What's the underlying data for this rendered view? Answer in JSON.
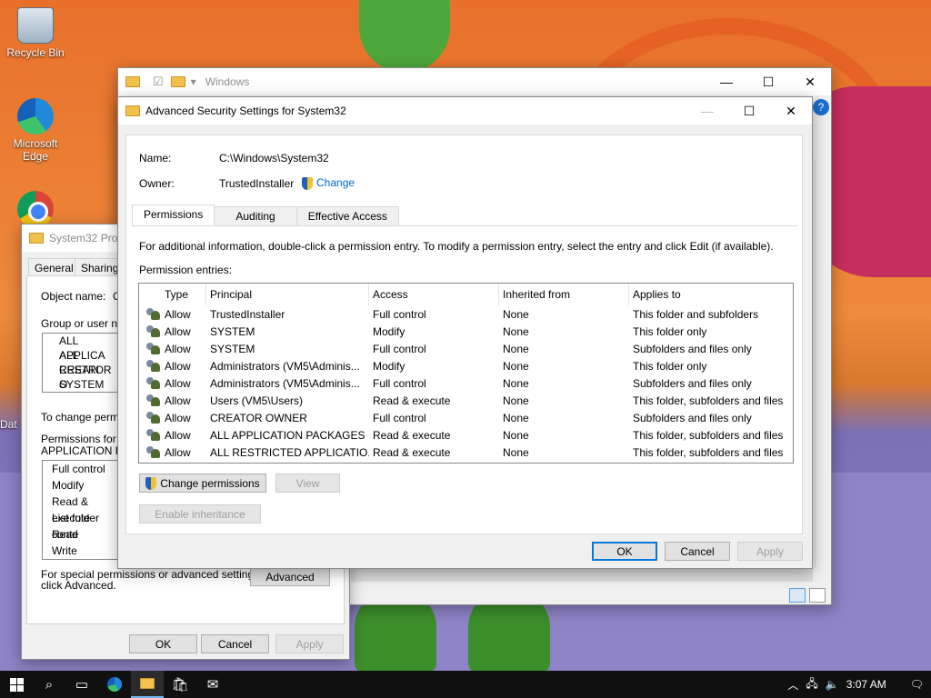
{
  "desktop": {
    "icons": [
      {
        "label": "Recycle Bin"
      },
      {
        "label": "Microsoft Edge"
      },
      {
        "label": "Dat"
      }
    ]
  },
  "explorer": {
    "title": "Windows"
  },
  "properties": {
    "title": "System32 Prop",
    "tabs": [
      "General",
      "Sharing"
    ],
    "object_name_label": "Object name:",
    "object_name_value": "C",
    "group_label": "Group or user nam",
    "groups": [
      "ALL APPLICA",
      "ALL RESTRI",
      "CREATOR O",
      "SYSTEM"
    ],
    "change_perms_text": "To change permis",
    "perms_for_label_1": "Permissions for AL",
    "perms_for_label_2": "APPLICATION PA",
    "perm_list": [
      "Full control",
      "Modify",
      "Read & execute",
      "List folder conte",
      "Read",
      "Write"
    ],
    "special_text_1": "For special permissions or advanced settings,",
    "special_text_2": "click Advanced.",
    "advanced_button": "Advanced",
    "ok_button": "OK",
    "cancel_button": "Cancel",
    "apply_button": "Apply"
  },
  "advanced": {
    "title": "Advanced Security Settings for System32",
    "name_label": "Name:",
    "name_value": "C:\\Windows\\System32",
    "owner_label": "Owner:",
    "owner_value": "TrustedInstaller",
    "change_link": "Change",
    "tabs": [
      "Permissions",
      "Auditing",
      "Effective Access"
    ],
    "info_text": "For additional information, double-click a permission entry. To modify a permission entry, select the entry and click Edit (if available).",
    "entries_label": "Permission entries:",
    "columns": [
      "Type",
      "Principal",
      "Access",
      "Inherited from",
      "Applies to"
    ],
    "rows": [
      [
        "Allow",
        "TrustedInstaller",
        "Full control",
        "None",
        "This folder and subfolders"
      ],
      [
        "Allow",
        "SYSTEM",
        "Modify",
        "None",
        "This folder only"
      ],
      [
        "Allow",
        "SYSTEM",
        "Full control",
        "None",
        "Subfolders and files only"
      ],
      [
        "Allow",
        "Administrators (VM5\\Adminis...",
        "Modify",
        "None",
        "This folder only"
      ],
      [
        "Allow",
        "Administrators (VM5\\Adminis...",
        "Full control",
        "None",
        "Subfolders and files only"
      ],
      [
        "Allow",
        "Users (VM5\\Users)",
        "Read & execute",
        "None",
        "This folder, subfolders and files"
      ],
      [
        "Allow",
        "CREATOR OWNER",
        "Full control",
        "None",
        "Subfolders and files only"
      ],
      [
        "Allow",
        "ALL APPLICATION PACKAGES",
        "Read & execute",
        "None",
        "This folder, subfolders and files"
      ],
      [
        "Allow",
        "ALL RESTRICTED APPLICATIO...",
        "Read & execute",
        "None",
        "This folder, subfolders and files"
      ]
    ],
    "change_permissions_button": "Change permissions",
    "view_button": "View",
    "enable_inheritance_button": "Enable inheritance",
    "ok_button": "OK",
    "cancel_button": "Cancel",
    "apply_button": "Apply"
  },
  "taskbar": {
    "time": "3:07 AM"
  }
}
